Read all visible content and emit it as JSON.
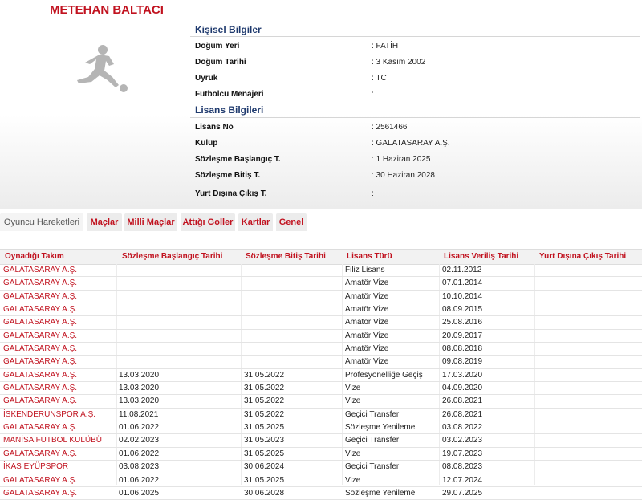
{
  "player": {
    "name": "METEHAN BALTACI"
  },
  "personal": {
    "title": "Kişisel Bilgiler",
    "fields": [
      {
        "label": "Doğum Yeri",
        "value": ":  FATİH"
      },
      {
        "label": "Doğum Tarihi",
        "value": ":  3 Kasım 2002"
      },
      {
        "label": "Uyruk",
        "value": ":  TC"
      },
      {
        "label": "Futbolcu Menajeri",
        "value": ":"
      }
    ]
  },
  "license": {
    "title": "Lisans Bilgileri",
    "fields": [
      {
        "label": "Lisans No",
        "value": ": 2561466"
      },
      {
        "label": "Kulüp",
        "value": ": GALATASARAY A.Ş."
      },
      {
        "label": "Sözleşme Başlangıç T.",
        "value": ": 1 Haziran 2025"
      },
      {
        "label": "Sözleşme Bitiş T.",
        "value": ": 30 Haziran 2028"
      },
      {
        "label": "Yurt Dışına Çıkış T.",
        "value": ":"
      }
    ]
  },
  "tabs": [
    {
      "label": "Oyuncu Hareketleri"
    },
    {
      "label": "Maçlar"
    },
    {
      "label": "Milli Maçlar"
    },
    {
      "label": "Attığı Goller"
    },
    {
      "label": "Kartlar"
    },
    {
      "label": "Genel"
    }
  ],
  "table": {
    "headers": [
      "Oynadığı Takım",
      "Sözleşme Başlangıç Tarihi",
      "Sözleşme Bitiş Tarihi",
      "Lisans Türü",
      "Lisans Veriliş Tarihi",
      "Yurt Dışına Çıkış Tarihi"
    ],
    "rows": [
      [
        "GALATASARAY A.Ş.",
        "",
        "",
        "Filiz Lisans",
        "02.11.2012",
        ""
      ],
      [
        "GALATASARAY A.Ş.",
        "",
        "",
        "Amatör Vize",
        "07.01.2014",
        ""
      ],
      [
        "GALATASARAY A.Ş.",
        "",
        "",
        "Amatör Vize",
        "10.10.2014",
        ""
      ],
      [
        "GALATASARAY A.Ş.",
        "",
        "",
        "Amatör Vize",
        "08.09.2015",
        ""
      ],
      [
        "GALATASARAY A.Ş.",
        "",
        "",
        "Amatör Vize",
        "25.08.2016",
        ""
      ],
      [
        "GALATASARAY A.Ş.",
        "",
        "",
        "Amatör Vize",
        "20.09.2017",
        ""
      ],
      [
        "GALATASARAY A.Ş.",
        "",
        "",
        "Amatör Vize",
        "08.08.2018",
        ""
      ],
      [
        "GALATASARAY A.Ş.",
        "",
        "",
        "Amatör Vize",
        "09.08.2019",
        ""
      ],
      [
        "GALATASARAY A.Ş.",
        "13.03.2020",
        "31.05.2022",
        "Profesyonelliğe Geçiş",
        "17.03.2020",
        ""
      ],
      [
        "GALATASARAY A.Ş.",
        "13.03.2020",
        "31.05.2022",
        "Vize",
        "04.09.2020",
        ""
      ],
      [
        "GALATASARAY A.Ş.",
        "13.03.2020",
        "31.05.2022",
        "Vize",
        "26.08.2021",
        ""
      ],
      [
        "İSKENDERUNSPOR A.Ş.",
        "11.08.2021",
        "31.05.2022",
        "Geçici Transfer",
        "26.08.2021",
        ""
      ],
      [
        "GALATASARAY A.Ş.",
        "01.06.2022",
        "31.05.2025",
        "Sözleşme Yenileme",
        "03.08.2022",
        ""
      ],
      [
        "MANİSA FUTBOL KULÜBÜ",
        "02.02.2023",
        "31.05.2023",
        "Geçici Transfer",
        "03.02.2023",
        ""
      ],
      [
        "GALATASARAY A.Ş.",
        "01.06.2022",
        "31.05.2025",
        "Vize",
        "19.07.2023",
        ""
      ],
      [
        "İKAS EYÜPSPOR",
        "03.08.2023",
        "30.06.2024",
        "Geçici Transfer",
        "08.08.2023",
        ""
      ],
      [
        "GALATASARAY A.Ş.",
        "01.06.2022",
        "31.05.2025",
        "Vize",
        "12.07.2024",
        ""
      ],
      [
        "GALATASARAY A.Ş.",
        "01.06.2025",
        "30.06.2028",
        "Sözleşme Yenileme",
        "29.07.2025",
        ""
      ]
    ]
  },
  "icons": {
    "player_silhouette": "footballer-silhouette-icon"
  },
  "colors": {
    "accent": "#c1121f",
    "section": "#1f3a6e"
  }
}
